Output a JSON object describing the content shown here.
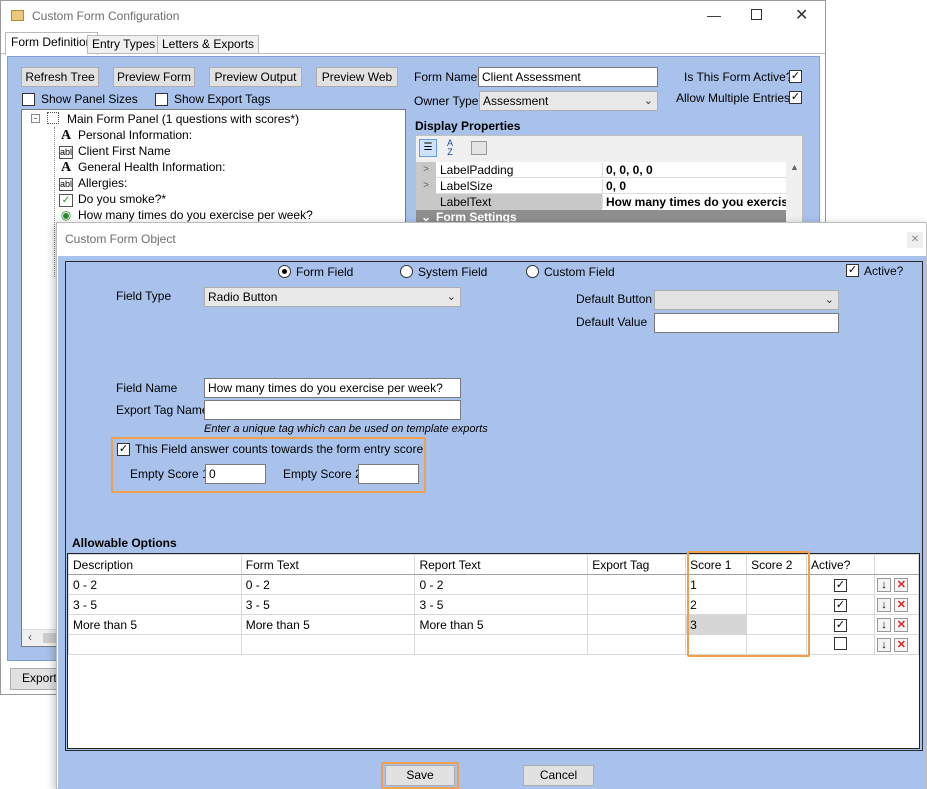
{
  "main_window": {
    "title": "Custom Form Configuration",
    "tabs": [
      "Form Definition",
      "Entry Types",
      "Letters & Exports"
    ],
    "toolbar": [
      "Refresh Tree",
      "Preview Form",
      "Preview Output",
      "Preview Web"
    ],
    "show_panel_sizes": "Show Panel Sizes",
    "show_export_tags": "Show Export Tags",
    "tree": {
      "root": "Main Form Panel (1 questions with scores*)",
      "items": [
        {
          "icon": "A",
          "label": "Personal Information:"
        },
        {
          "icon": "abl",
          "label": "Client First Name"
        },
        {
          "icon": "A",
          "label": "General Health Information:"
        },
        {
          "icon": "abl",
          "label": "Allergies:"
        },
        {
          "icon": "check",
          "label": "Do you smoke?*"
        },
        {
          "icon": "radio",
          "label": "How many times do you exercise per week?"
        }
      ]
    },
    "form_name_label": "Form Name",
    "form_name_value": "Client Assessment",
    "owner_type_label": "Owner Type",
    "owner_type_value": "Assessment",
    "is_active_label": "Is This Form Active?",
    "allow_multiple_label": "Allow Multiple Entries?",
    "display_properties": "Display Properties",
    "properties": [
      {
        "name": "LabelPadding",
        "value": "0, 0, 0, 0"
      },
      {
        "name": "LabelSize",
        "value": "0, 0"
      },
      {
        "name": "LabelText",
        "value": "How many times do you exercise"
      }
    ],
    "form_settings": "Form Settings",
    "export_button": "Export t"
  },
  "dialog": {
    "title": "Custom Form Object",
    "source_options": [
      "Form Field",
      "System Field",
      "Custom Field"
    ],
    "active_label": "Active?",
    "field_type_label": "Field Type",
    "field_type_value": "Radio Button",
    "default_button_label": "Default Button",
    "default_button_value": "",
    "default_value_label": "Default Value",
    "default_value_value": "",
    "field_name_label": "Field Name",
    "field_name_value": "How many times do you exercise per week?",
    "export_tag_label": "Export Tag Name",
    "export_tag_value": "",
    "export_tag_hint": "Enter a unique tag which can be used on template exports",
    "score_checkbox_label": "This Field answer counts towards the form entry score",
    "empty_score1_label": "Empty Score 1",
    "empty_score1_value": "0",
    "empty_score2_label": "Empty Score 2",
    "empty_score2_value": "",
    "allowable_options_title": "Allowable Options",
    "columns": [
      "Description",
      "Form Text",
      "Report Text",
      "Export Tag",
      "Score 1",
      "Score 2",
      "Active?"
    ],
    "rows": [
      {
        "description": "0 - 2",
        "form_text": "0 - 2",
        "report_text": "0 - 2",
        "export_tag": "",
        "score1": "1",
        "score2": "",
        "active": true
      },
      {
        "description": "3 - 5",
        "form_text": "3 - 5",
        "report_text": "3 - 5",
        "export_tag": "",
        "score1": "2",
        "score2": "",
        "active": true
      },
      {
        "description": "More than 5",
        "form_text": "More than 5",
        "report_text": "More than 5",
        "export_tag": "",
        "score1": "3",
        "score2": "",
        "active": true
      },
      {
        "description": "",
        "form_text": "",
        "report_text": "",
        "export_tag": "",
        "score1": "",
        "score2": "",
        "active": false
      }
    ],
    "save_label": "Save",
    "cancel_label": "Cancel"
  },
  "colors": {
    "panel_blue": "#a9c2ec",
    "highlight_orange": "#f0a04b",
    "delete_red": "#e02020"
  }
}
